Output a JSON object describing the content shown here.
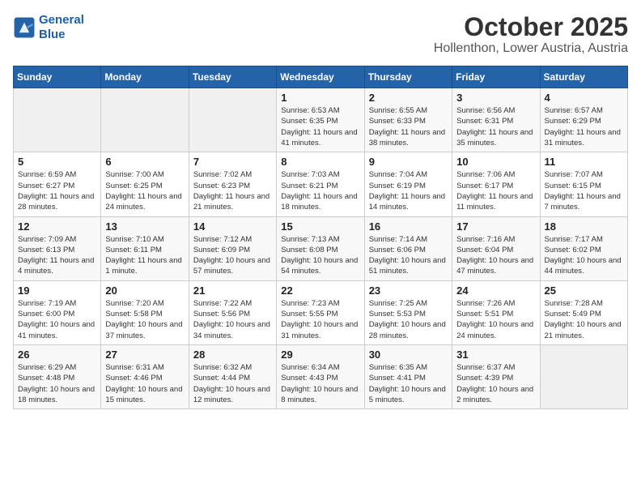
{
  "logo": {
    "line1": "General",
    "line2": "Blue"
  },
  "title": "October 2025",
  "location": "Hollenthon, Lower Austria, Austria",
  "weekdays": [
    "Sunday",
    "Monday",
    "Tuesday",
    "Wednesday",
    "Thursday",
    "Friday",
    "Saturday"
  ],
  "weeks": [
    [
      {
        "day": "",
        "info": ""
      },
      {
        "day": "",
        "info": ""
      },
      {
        "day": "",
        "info": ""
      },
      {
        "day": "1",
        "info": "Sunrise: 6:53 AM\nSunset: 6:35 PM\nDaylight: 11 hours and 41 minutes."
      },
      {
        "day": "2",
        "info": "Sunrise: 6:55 AM\nSunset: 6:33 PM\nDaylight: 11 hours and 38 minutes."
      },
      {
        "day": "3",
        "info": "Sunrise: 6:56 AM\nSunset: 6:31 PM\nDaylight: 11 hours and 35 minutes."
      },
      {
        "day": "4",
        "info": "Sunrise: 6:57 AM\nSunset: 6:29 PM\nDaylight: 11 hours and 31 minutes."
      }
    ],
    [
      {
        "day": "5",
        "info": "Sunrise: 6:59 AM\nSunset: 6:27 PM\nDaylight: 11 hours and 28 minutes."
      },
      {
        "day": "6",
        "info": "Sunrise: 7:00 AM\nSunset: 6:25 PM\nDaylight: 11 hours and 24 minutes."
      },
      {
        "day": "7",
        "info": "Sunrise: 7:02 AM\nSunset: 6:23 PM\nDaylight: 11 hours and 21 minutes."
      },
      {
        "day": "8",
        "info": "Sunrise: 7:03 AM\nSunset: 6:21 PM\nDaylight: 11 hours and 18 minutes."
      },
      {
        "day": "9",
        "info": "Sunrise: 7:04 AM\nSunset: 6:19 PM\nDaylight: 11 hours and 14 minutes."
      },
      {
        "day": "10",
        "info": "Sunrise: 7:06 AM\nSunset: 6:17 PM\nDaylight: 11 hours and 11 minutes."
      },
      {
        "day": "11",
        "info": "Sunrise: 7:07 AM\nSunset: 6:15 PM\nDaylight: 11 hours and 7 minutes."
      }
    ],
    [
      {
        "day": "12",
        "info": "Sunrise: 7:09 AM\nSunset: 6:13 PM\nDaylight: 11 hours and 4 minutes."
      },
      {
        "day": "13",
        "info": "Sunrise: 7:10 AM\nSunset: 6:11 PM\nDaylight: 11 hours and 1 minute."
      },
      {
        "day": "14",
        "info": "Sunrise: 7:12 AM\nSunset: 6:09 PM\nDaylight: 10 hours and 57 minutes."
      },
      {
        "day": "15",
        "info": "Sunrise: 7:13 AM\nSunset: 6:08 PM\nDaylight: 10 hours and 54 minutes."
      },
      {
        "day": "16",
        "info": "Sunrise: 7:14 AM\nSunset: 6:06 PM\nDaylight: 10 hours and 51 minutes."
      },
      {
        "day": "17",
        "info": "Sunrise: 7:16 AM\nSunset: 6:04 PM\nDaylight: 10 hours and 47 minutes."
      },
      {
        "day": "18",
        "info": "Sunrise: 7:17 AM\nSunset: 6:02 PM\nDaylight: 10 hours and 44 minutes."
      }
    ],
    [
      {
        "day": "19",
        "info": "Sunrise: 7:19 AM\nSunset: 6:00 PM\nDaylight: 10 hours and 41 minutes."
      },
      {
        "day": "20",
        "info": "Sunrise: 7:20 AM\nSunset: 5:58 PM\nDaylight: 10 hours and 37 minutes."
      },
      {
        "day": "21",
        "info": "Sunrise: 7:22 AM\nSunset: 5:56 PM\nDaylight: 10 hours and 34 minutes."
      },
      {
        "day": "22",
        "info": "Sunrise: 7:23 AM\nSunset: 5:55 PM\nDaylight: 10 hours and 31 minutes."
      },
      {
        "day": "23",
        "info": "Sunrise: 7:25 AM\nSunset: 5:53 PM\nDaylight: 10 hours and 28 minutes."
      },
      {
        "day": "24",
        "info": "Sunrise: 7:26 AM\nSunset: 5:51 PM\nDaylight: 10 hours and 24 minutes."
      },
      {
        "day": "25",
        "info": "Sunrise: 7:28 AM\nSunset: 5:49 PM\nDaylight: 10 hours and 21 minutes."
      }
    ],
    [
      {
        "day": "26",
        "info": "Sunrise: 6:29 AM\nSunset: 4:48 PM\nDaylight: 10 hours and 18 minutes."
      },
      {
        "day": "27",
        "info": "Sunrise: 6:31 AM\nSunset: 4:46 PM\nDaylight: 10 hours and 15 minutes."
      },
      {
        "day": "28",
        "info": "Sunrise: 6:32 AM\nSunset: 4:44 PM\nDaylight: 10 hours and 12 minutes."
      },
      {
        "day": "29",
        "info": "Sunrise: 6:34 AM\nSunset: 4:43 PM\nDaylight: 10 hours and 8 minutes."
      },
      {
        "day": "30",
        "info": "Sunrise: 6:35 AM\nSunset: 4:41 PM\nDaylight: 10 hours and 5 minutes."
      },
      {
        "day": "31",
        "info": "Sunrise: 6:37 AM\nSunset: 4:39 PM\nDaylight: 10 hours and 2 minutes."
      },
      {
        "day": "",
        "info": ""
      }
    ]
  ]
}
